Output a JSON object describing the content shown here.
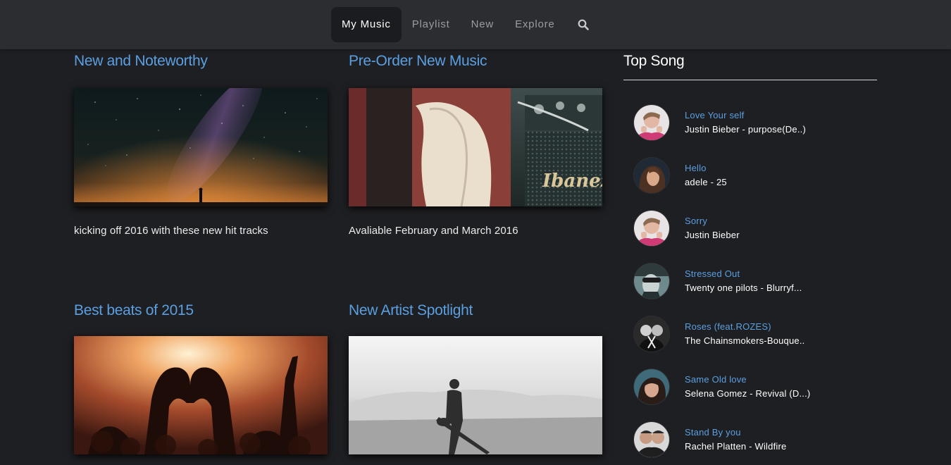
{
  "nav": {
    "items": [
      {
        "label": "My Music",
        "active": true
      },
      {
        "label": "Playlist",
        "active": false
      },
      {
        "label": "New",
        "active": false
      },
      {
        "label": "Explore",
        "active": false
      }
    ],
    "search_icon": "search-icon"
  },
  "cards": [
    {
      "title": "New and Noteworthy",
      "description": "kicking off 2016 with these new hit tracks",
      "image": "starry-night-sky"
    },
    {
      "title": "Pre-Order New Music",
      "description": "Avaliable February and March 2016",
      "image": "guitar-and-amp"
    },
    {
      "title": "Best beats of 2015",
      "description": "",
      "image": "concert-crowd-hands"
    },
    {
      "title": "New Artist Spotlight",
      "description": "",
      "image": "desert-guitarist"
    }
  ],
  "sidebar": {
    "title": "Top Song",
    "songs": [
      {
        "title": "Love Your self",
        "artist": "Justin Bieber - purpose(De..)"
      },
      {
        "title": "Hello",
        "artist": "adele - 25"
      },
      {
        "title": "Sorry",
        "artist": "Justin Bieber"
      },
      {
        "title": "Stressed Out",
        "artist": "Twenty one pilots - Blurryf..."
      },
      {
        "title": "Roses (feat.ROZES)",
        "artist": "The Chainsmokers-Bouque.."
      },
      {
        "title": "Same Old love",
        "artist": "Selena Gomez - Revival (D...)"
      },
      {
        "title": "Stand By you",
        "artist": "Rachel Platten - Wildfire"
      }
    ]
  },
  "colors": {
    "background": "#1e1f23",
    "topbar": "#2c2d31",
    "accent": "#5b9fe0",
    "text": "#ffffff"
  }
}
